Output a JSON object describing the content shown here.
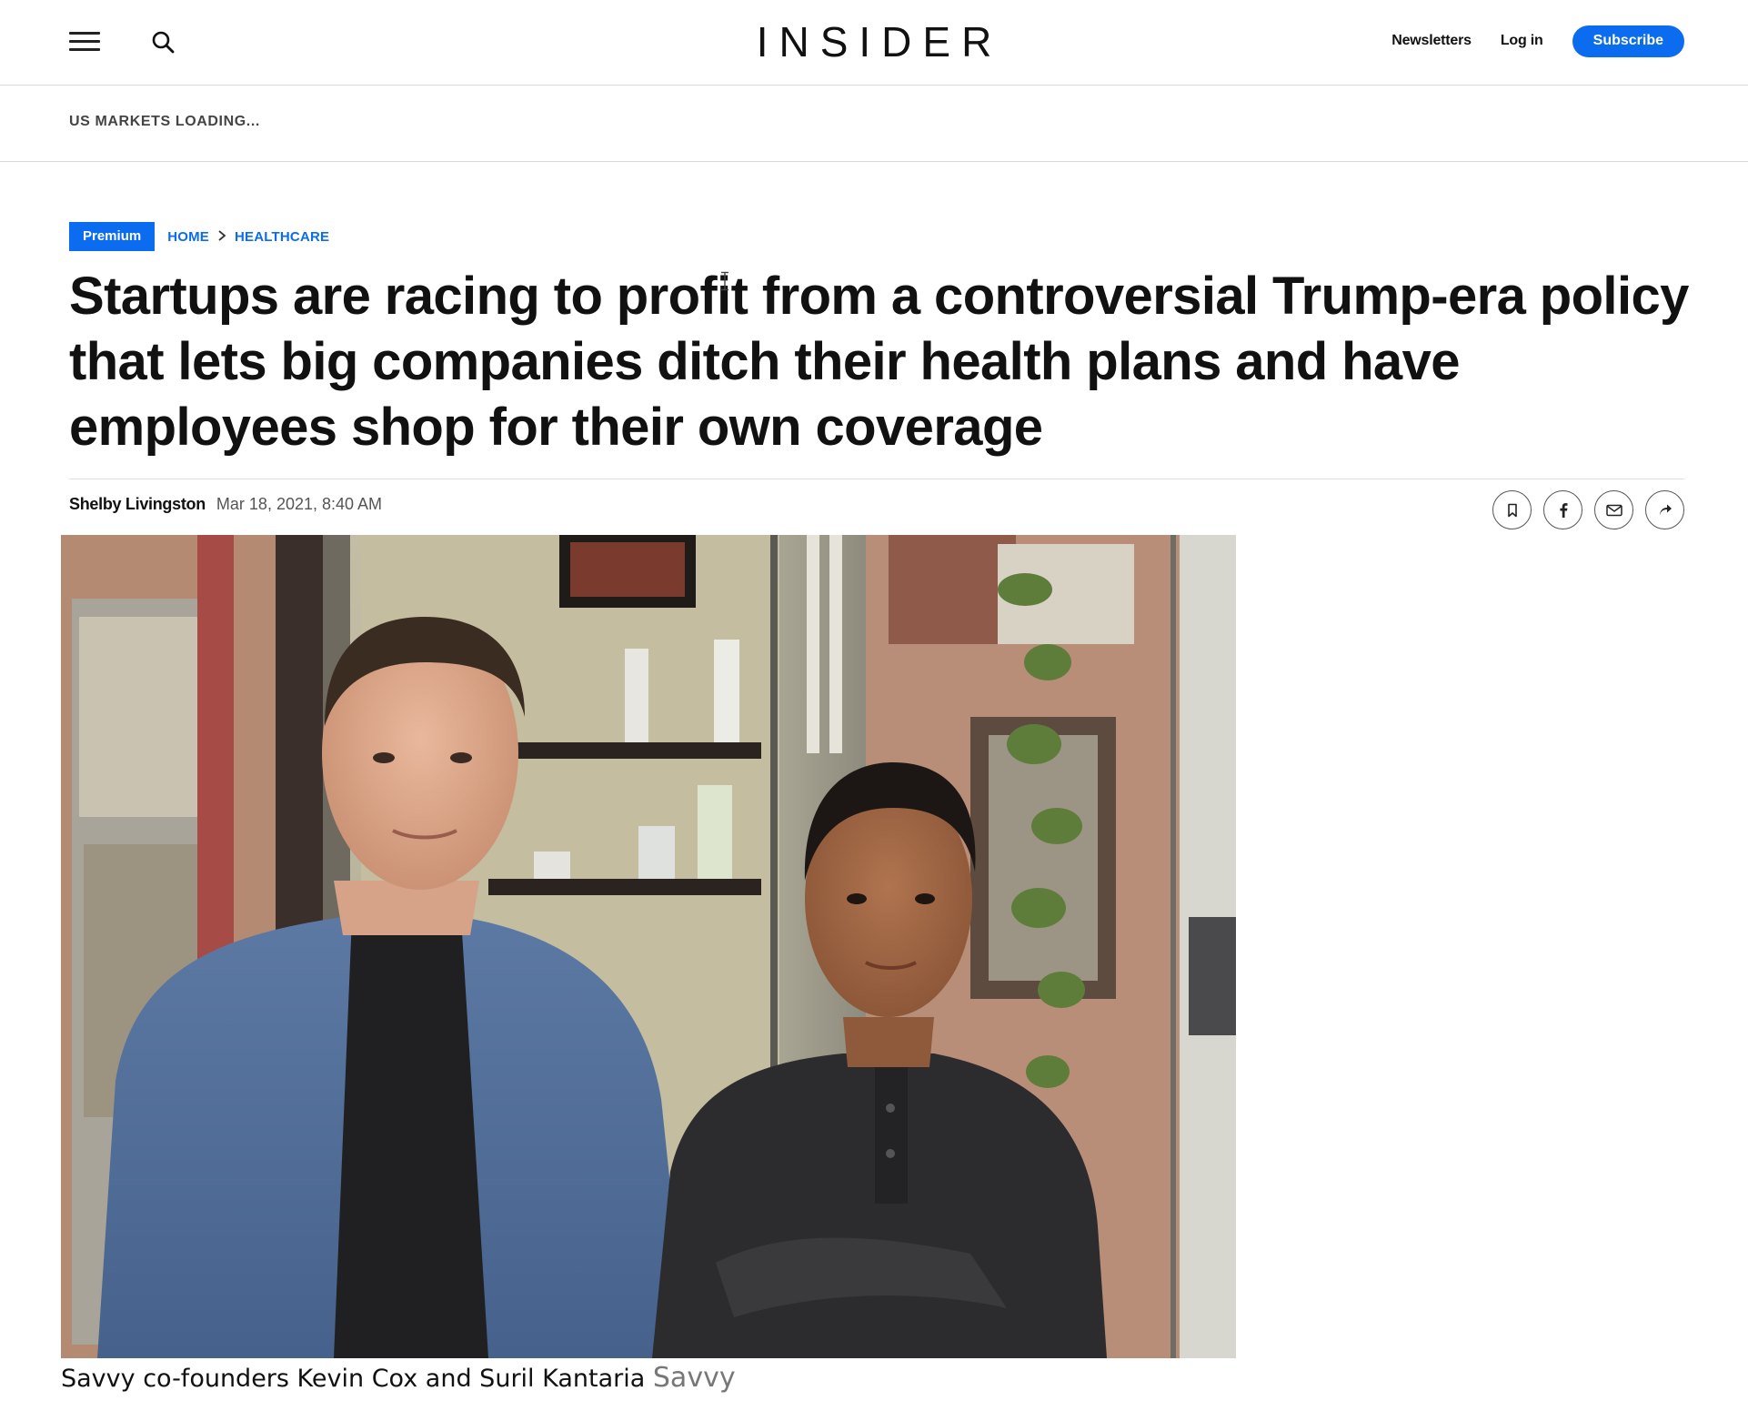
{
  "header": {
    "logo": "INSIDER",
    "nav": {
      "newsletters": "Newsletters",
      "login": "Log in",
      "subscribe": "Subscribe"
    }
  },
  "markets": {
    "status": "US MARKETS LOADING..."
  },
  "breadcrumb": {
    "badge": "Premium",
    "home": "HOME",
    "section": "HEALTHCARE",
    "separator": "›"
  },
  "article": {
    "headline": "Startups are racing to profit from a controversial Trump-era policy that lets big companies ditch their health plans and have employees shop for their own coverage",
    "author": "Shelby Livingston",
    "date": "Mar 18, 2021, 8:40 AM",
    "share_icons": [
      "bookmark-icon",
      "facebook-icon",
      "email-icon",
      "share-arrow-icon"
    ]
  },
  "photo": {
    "caption": "Savvy co-founders Kevin Cox and Suril Kantaria",
    "credit": "Savvy"
  },
  "colors": {
    "accent": "#0b6cf0",
    "text": "#111111",
    "divider": "#d9d9d9"
  }
}
